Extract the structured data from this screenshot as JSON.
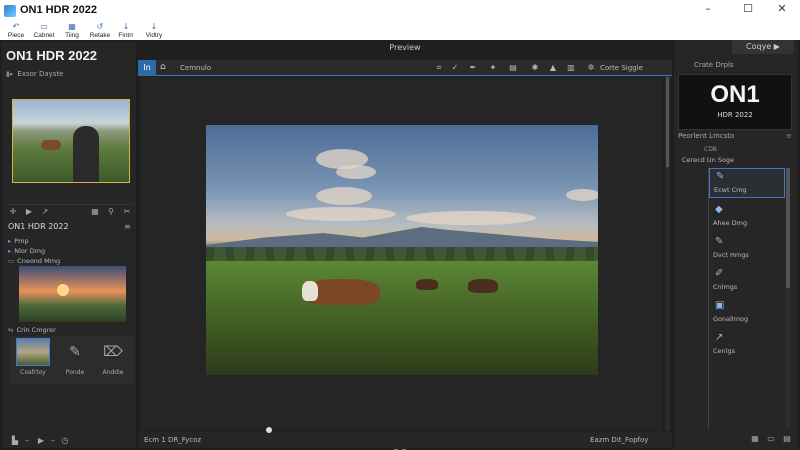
{
  "window": {
    "title": "ON1 HDR 2022",
    "controls": [
      "–",
      "☐",
      "✕"
    ]
  },
  "menubar": {
    "items": [
      {
        "label": "Piece",
        "icon": "↶"
      },
      {
        "label": "Cabnet",
        "icon": "▭"
      },
      {
        "label": "Tiing",
        "icon": "▦"
      },
      {
        "label": "Retake",
        "icon": "↺"
      },
      {
        "label": "Fintrr",
        "icon": "↓"
      },
      {
        "label": "Vidtry",
        "icon": "↓"
      }
    ]
  },
  "left_panel": {
    "brand": "ON1 HDR 2022",
    "navigator_head": "Exsor Dayste",
    "panel2_title": "ON1 HDR 2022",
    "panel2_menu": "≡",
    "rows": [
      "Pmp",
      "Nlor Dmg",
      "Cneond Mmg"
    ],
    "section_label": "Crin Cmgrer",
    "presets": [
      {
        "label": "Coafrtoy"
      },
      {
        "label": "Ponde"
      },
      {
        "label": "Anddie"
      }
    ]
  },
  "center": {
    "preview_title": "Preview",
    "toolbar": {
      "tab_label": "In",
      "breadcrumb": "Cemnulo",
      "view_label": "Corte Siggle"
    },
    "bottom_file_label": "Ecm 1 DR_Fycoz",
    "bottom_right_label": "Eazm Dit_Fopfoy"
  },
  "right_panel": {
    "preview_button": "Coqye ▶",
    "head1": "Crate Drpls",
    "logo_big": "ON1",
    "logo_small": "HDR 2022",
    "head2": "Peorlent Lmcsto",
    "head2_menu": "≡",
    "sub1": "CDB",
    "sub2": "Cerecd Un Soge",
    "effects": [
      {
        "label": "Ecwt Cmg",
        "icon": "✎",
        "selected": true
      },
      {
        "label": "Ahee Dmg",
        "icon": "◆",
        "selected": false
      },
      {
        "label": "Dvct Hmgs",
        "icon": "✎",
        "selected": false
      },
      {
        "label": "Cnlmgs",
        "icon": "✐",
        "selected": false
      },
      {
        "label": "Gonallmog",
        "icon": "▣",
        "selected": false
      },
      {
        "label": "Cenlgs",
        "icon": "↗",
        "selected": false
      }
    ]
  }
}
